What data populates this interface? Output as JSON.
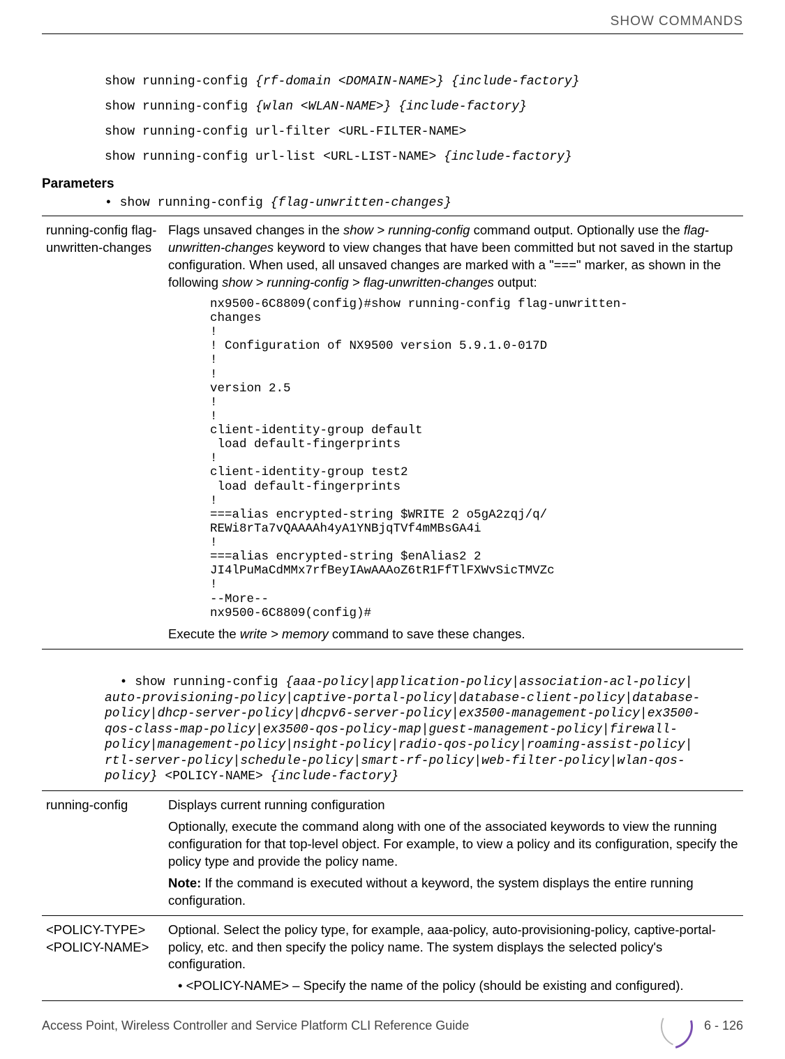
{
  "header": {
    "category": "SHOW COMMANDS"
  },
  "commands": {
    "c1a": "show running-config ",
    "c1b": "{rf-domain <DOMAIN-NAME>} {include-factory}",
    "c2a": "show running-config ",
    "c2b": "{wlan <WLAN-NAME>} {include-factory}",
    "c3": "show running-config url-filter <URL-FILTER-NAME>",
    "c4a": "show running-config url-list <URL-LIST-NAME> ",
    "c4b": "{include-factory}"
  },
  "section": {
    "parameters": "Parameters"
  },
  "bullet1": {
    "prefix": "• show running-config ",
    "ital": "{flag-unwritten-changes}"
  },
  "table1": {
    "left": "running-config flag-unwritten-changes",
    "d1a": "Flags unsaved changes in the ",
    "d1b": "show > running-config",
    "d1c": " command output. Optionally use the ",
    "d1d": "flag-unwritten-changes",
    "d1e": " keyword to view changes that have been committed but not saved in the startup configuration. When used, all unsaved changes are marked with a \"===\" marker, as shown in the following ",
    "d1f": "show > running-config > flag-unwritten-changes",
    "d1g": " output:",
    "code": "nx9500-6C8809(config)#show running-config flag-unwritten-\nchanges\n!\n! Configuration of NX9500 version 5.9.1.0-017D\n!\n!\nversion 2.5\n!\n!\nclient-identity-group default\n load default-fingerprints\n!\nclient-identity-group test2\n load default-fingerprints\n!\n===alias encrypted-string $WRITE 2 o5gA2zqj/q/\nREWi8rTa7vQAAAAh4yA1YNBjqTVf4mMBsGA4i\n!\n===alias encrypted-string $enAlias2 2 \nJI4lPuMaCdMMx7rfBeyIAwAAAoZ6tR1FfTlFXWvSicTMVZc\n!\n--More--\nnx9500-6C8809(config)#",
    "d2a": "Execute the ",
    "d2b": "write > memory",
    "d2c": " command to save these changes."
  },
  "bullet2": {
    "prefix": "• show running-config ",
    "ital": "{aaa-policy|application-policy|association-acl-policy|\nauto-provisioning-policy|captive-portal-policy|database-client-policy|database-\npolicy|dhcp-server-policy|dhcpv6-server-policy|ex3500-management-policy|ex3500-\nqos-class-map-policy|ex3500-qos-policy-map|guest-management-policy|firewall-\npolicy|management-policy|nsight-policy|radio-qos-policy|roaming-assist-policy|\nrtl-server-policy|schedule-policy|smart-rf-policy|web-filter-policy|wlan-qos-\npolicy}",
    "tail": " <POLICY-NAME> ",
    "tail_ital": "{include-factory}"
  },
  "table2": {
    "r1_left": "running-config",
    "r1_p1": "Displays current running configuration",
    "r1_p2": "Optionally, execute the command along with one of the associated keywords to view the running configuration for that top-level object. For example, to view a policy and its configuration, specify the policy type and provide the policy name.",
    "r1_note_label": "Note:",
    "r1_note": " If the command is executed without a keyword, the system displays the entire running configuration.",
    "r2_left": "<POLICY-TYPE> <POLICY-NAME>",
    "r2_p1": "Optional. Select the policy type, for example, aaa-policy, auto-provisioning-policy, captive-portal-policy, etc. and then specify the policy name. The system displays the selected policy's configuration.",
    "r2_sub": "• <POLICY-NAME> – Specify the name of the policy (should be existing and configured)."
  },
  "footer": {
    "title": "Access Point, Wireless Controller and Service Platform CLI Reference Guide",
    "page": "6 - 126"
  }
}
